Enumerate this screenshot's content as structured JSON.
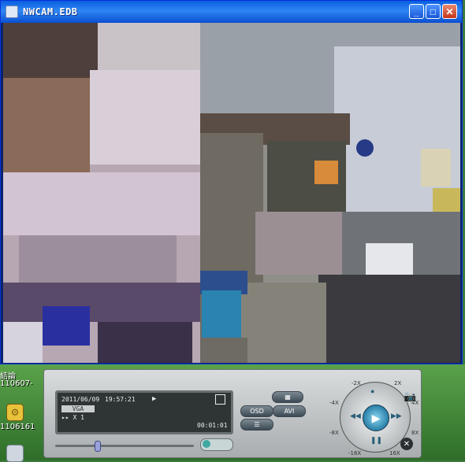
{
  "window": {
    "title": "NWCAM.EDB"
  },
  "title_buttons": {
    "minimize": "_",
    "maximize": "□",
    "close": "✕"
  },
  "desktop": {
    "items": [
      {
        "label": "結論",
        "sub": "110607-"
      },
      {
        "label": "1106161"
      }
    ]
  },
  "player": {
    "date": "2011/06/09",
    "time": "19:57:21",
    "resolution": "VGA",
    "speed": "▸▸ X 1",
    "counter": "00:01:01",
    "playback_progress_percent": 30,
    "buttons": {
      "osd": "OSD",
      "avi": "AVI"
    },
    "dial": {
      "labels": [
        "-2X",
        "2X",
        "-4X",
        "4X",
        "-8X",
        "8X",
        "-16X",
        "16X"
      ]
    }
  }
}
